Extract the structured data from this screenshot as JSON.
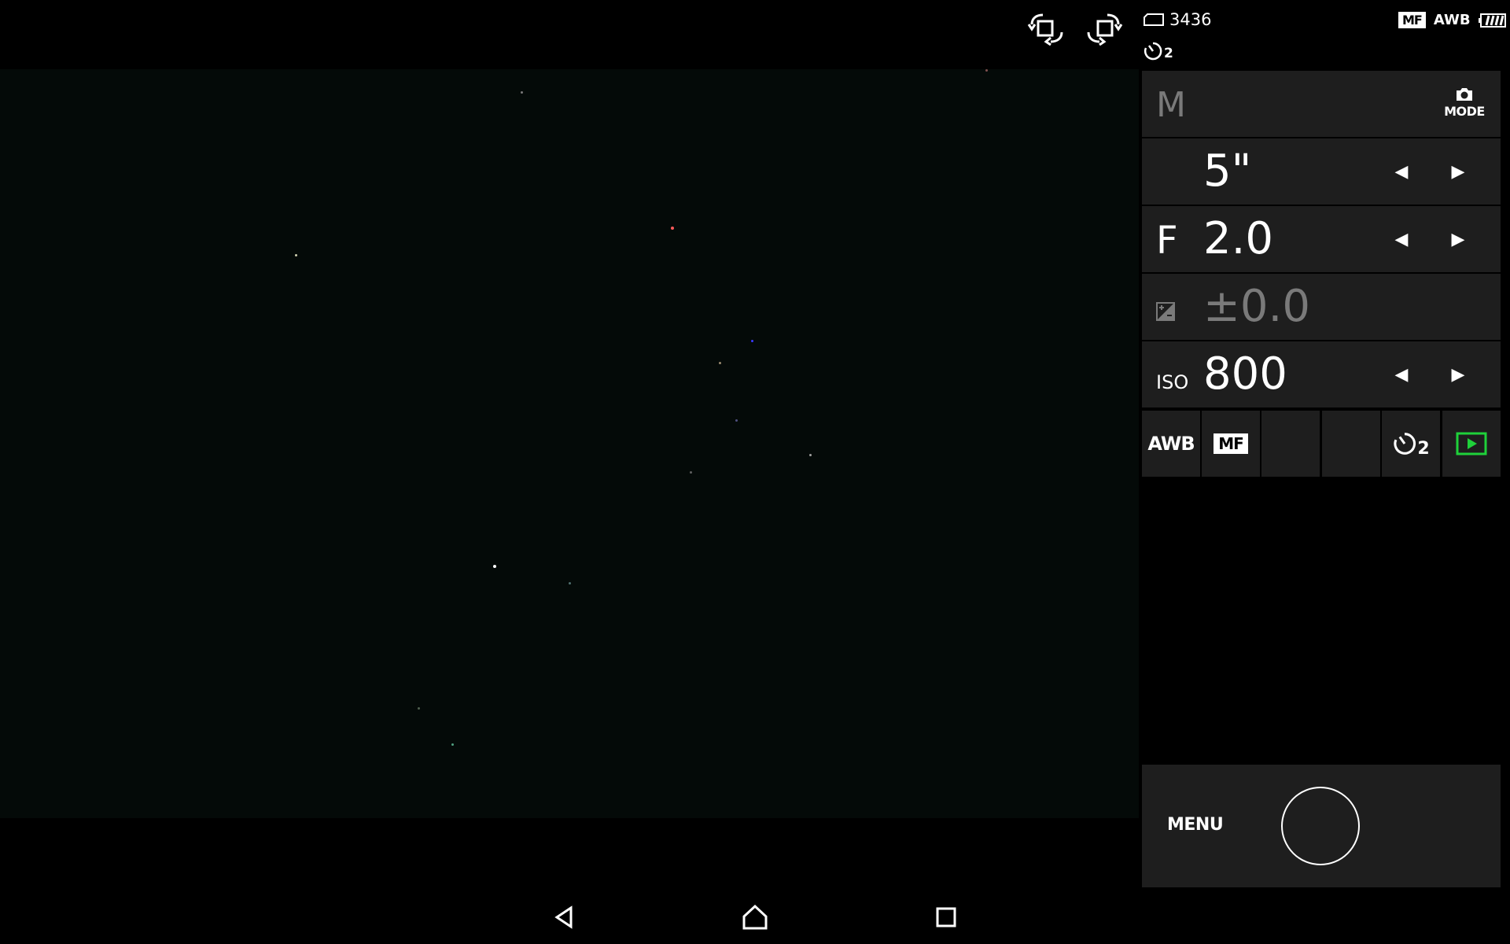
{
  "status_bar": {
    "shots_remaining": "3436",
    "focus_mode_badge": "MF",
    "white_balance": "AWB",
    "self_timer": "2"
  },
  "camera_panel": {
    "mode": {
      "value": "M",
      "button_label": "MODE"
    },
    "shutter_speed": {
      "value": "5\""
    },
    "aperture": {
      "label": "F",
      "value": "2.0"
    },
    "exposure_comp": {
      "value": "±0.0"
    },
    "iso": {
      "label": "ISO",
      "value": "800"
    }
  },
  "quick_settings": {
    "white_balance": "AWB",
    "focus_mode": "MF",
    "self_timer": "2"
  },
  "shutter_area": {
    "menu_label": "MENU"
  },
  "icons": {
    "rotate_left": "rotate-left-icon",
    "rotate_right": "rotate-right-icon",
    "memory_card": "memory-card-icon",
    "battery": "battery-icon",
    "camera": "camera-icon",
    "exposure": "exposure-comp-icon",
    "playback": "playback-icon",
    "back": "back-icon",
    "home": "home-icon",
    "recents": "recents-icon"
  },
  "colors": {
    "panel_bg": "#1e1e1e",
    "playback_accent": "#1fd13a",
    "disabled_text": "#7a7a7a"
  }
}
